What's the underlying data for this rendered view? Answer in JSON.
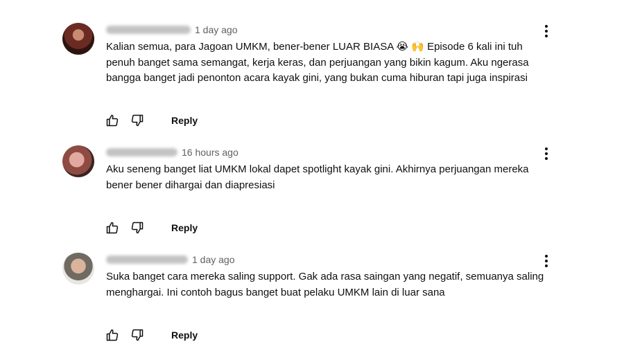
{
  "comments": [
    {
      "handle": "@Triyakusuma-xf4",
      "time": "1 day ago",
      "text": "Kalian semua, para Jagoan UMKM, bener-bener LUAR BIASA 😭 🙌 Episode 6 kali ini tuh\npenuh banget sama semangat, kerja keras, dan perjuangan yang bikin kagum. Aku ngerasa\nbangga banget jadi penonton acara kayak gini, yang bukan cuma hiburan tapi juga inspirasi",
      "reply_label": "Reply"
    },
    {
      "handle": "@faridaaristeyo",
      "time": "16 hours ago",
      "text": "Aku seneng banget liat UMKM lokal dapet spotlight kayak gini. Akhirnya perjuangan mereka\nbener bener dihargai dan diapresiasi",
      "reply_label": "Reply"
    },
    {
      "handle": "@lestiwatiagustia",
      "time": "1 day ago",
      "text": "Suka banget cara mereka saling support. Gak ada rasa saingan yang negatif, semuanya saling\nmenghargai. Ini contoh bagus banget buat pelaku UMKM lain di luar sana",
      "reply_label": "Reply"
    }
  ],
  "icons": {
    "like": "thumb-up-icon",
    "dislike": "thumb-down-icon",
    "more": "more-vert-icon"
  }
}
